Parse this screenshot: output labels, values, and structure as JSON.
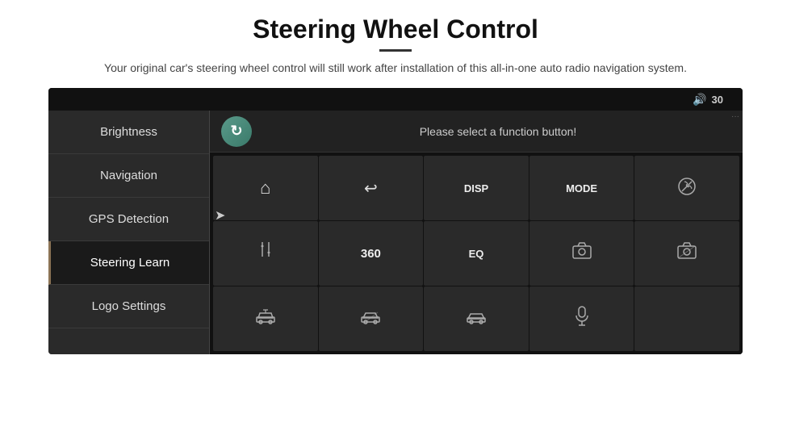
{
  "header": {
    "title": "Steering Wheel Control",
    "subtitle": "Your original car's steering wheel control will still work after installation of this all-in-one auto radio navigation system."
  },
  "topbar": {
    "volume_icon": "🔊",
    "volume_value": "30"
  },
  "sidebar": {
    "items": [
      {
        "id": "brightness",
        "label": "Brightness",
        "active": false
      },
      {
        "id": "navigation",
        "label": "Navigation",
        "active": false
      },
      {
        "id": "gps-detection",
        "label": "GPS Detection",
        "active": false
      },
      {
        "id": "steering-learn",
        "label": "Steering Learn",
        "active": true
      },
      {
        "id": "logo-settings",
        "label": "Logo Settings",
        "active": false
      }
    ]
  },
  "function_bar": {
    "prompt": "Please select a function button!"
  },
  "grid": {
    "cells": [
      {
        "id": "home-btn",
        "type": "icon",
        "icon": "home",
        "label": ""
      },
      {
        "id": "back-btn",
        "type": "icon",
        "icon": "back",
        "label": ""
      },
      {
        "id": "disp-btn",
        "type": "label",
        "label": "DISP"
      },
      {
        "id": "mode-btn",
        "type": "label",
        "label": "MODE"
      },
      {
        "id": "nophone-btn",
        "type": "icon",
        "icon": "nophone",
        "label": ""
      },
      {
        "id": "tune-btn",
        "type": "icon",
        "icon": "tune",
        "label": ""
      },
      {
        "id": "360-btn",
        "type": "label",
        "label": "360"
      },
      {
        "id": "eq-btn",
        "type": "label",
        "label": "EQ"
      },
      {
        "id": "camera1-btn",
        "type": "icon",
        "icon": "camera",
        "label": ""
      },
      {
        "id": "camera2-btn",
        "type": "icon",
        "icon": "camera2",
        "label": ""
      },
      {
        "id": "car1-btn",
        "type": "icon",
        "icon": "car1",
        "label": ""
      },
      {
        "id": "car2-btn",
        "type": "icon",
        "icon": "car2",
        "label": ""
      },
      {
        "id": "car3-btn",
        "type": "icon",
        "icon": "car3",
        "label": ""
      },
      {
        "id": "mic-btn",
        "type": "icon",
        "icon": "mic",
        "label": ""
      },
      {
        "id": "empty-btn",
        "type": "empty",
        "label": ""
      }
    ]
  }
}
